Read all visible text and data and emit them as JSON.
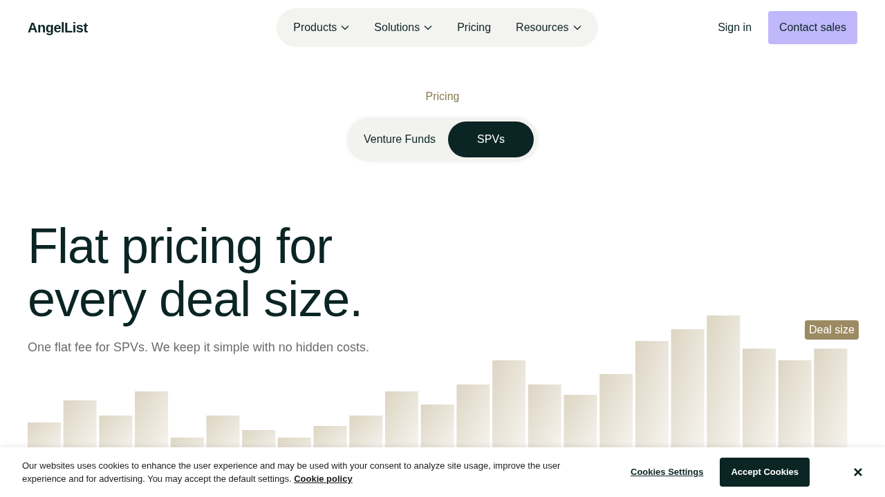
{
  "header": {
    "logo": "AngelList",
    "nav": [
      {
        "label": "Products",
        "dropdown": true
      },
      {
        "label": "Solutions",
        "dropdown": true
      },
      {
        "label": "Pricing",
        "dropdown": false
      },
      {
        "label": "Resources",
        "dropdown": true
      }
    ],
    "sign_in": "Sign in",
    "contact": "Contact sales"
  },
  "eyebrow": "Pricing",
  "tabs": [
    {
      "label": "Venture Funds",
      "selected": false
    },
    {
      "label": "SPVs",
      "selected": true
    }
  ],
  "hero": {
    "title_lines": [
      "Flat pricing for",
      "every deal size."
    ],
    "subtitle": "One flat fee for SPVs. We keep it simple with no hidden costs."
  },
  "chart_label": "Deal size",
  "cookie": {
    "text": "Our websites uses cookies to enhance the user experience and may be used with your consent to analyze site usage, improve the user experience and for advertising. You may accept the default settings.",
    "link": "Cookie policy",
    "settings": "Cookies Settings",
    "accept": "Accept Cookies"
  }
}
